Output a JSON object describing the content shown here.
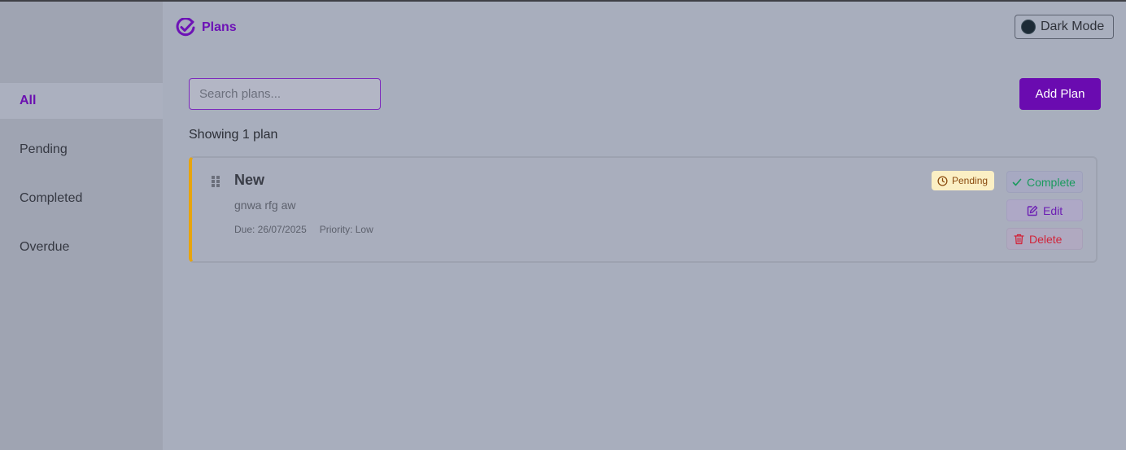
{
  "app": {
    "title": "Plans"
  },
  "header": {
    "dark_mode_label": "Dark Mode"
  },
  "sidebar": {
    "items": [
      {
        "label": "All",
        "active": true
      },
      {
        "label": "Pending",
        "active": false
      },
      {
        "label": "Completed",
        "active": false
      },
      {
        "label": "Overdue",
        "active": false
      }
    ]
  },
  "toolbar": {
    "search_placeholder": "Search plans...",
    "search_value": "",
    "add_label": "Add Plan"
  },
  "list": {
    "count_text": "Showing 1 plan",
    "plans": [
      {
        "title": "New",
        "description": "gnwa rfg aw",
        "due": "Due: 26/07/2025",
        "priority": "Priority: Low",
        "status": "Pending",
        "actions": {
          "complete": "Complete",
          "edit": "Edit",
          "delete": "Delete"
        }
      }
    ]
  },
  "colors": {
    "accent": "#6a0bb0",
    "pending": "#e7a40e",
    "complete": "#1a9a5e",
    "delete": "#d1243a"
  },
  "icons": {
    "brand": "check-circle-icon",
    "theme": "moon-icon",
    "drag": "drag-handle-icon",
    "status": "clock-icon",
    "complete": "check-icon",
    "edit": "edit-icon",
    "delete": "trash-icon"
  }
}
